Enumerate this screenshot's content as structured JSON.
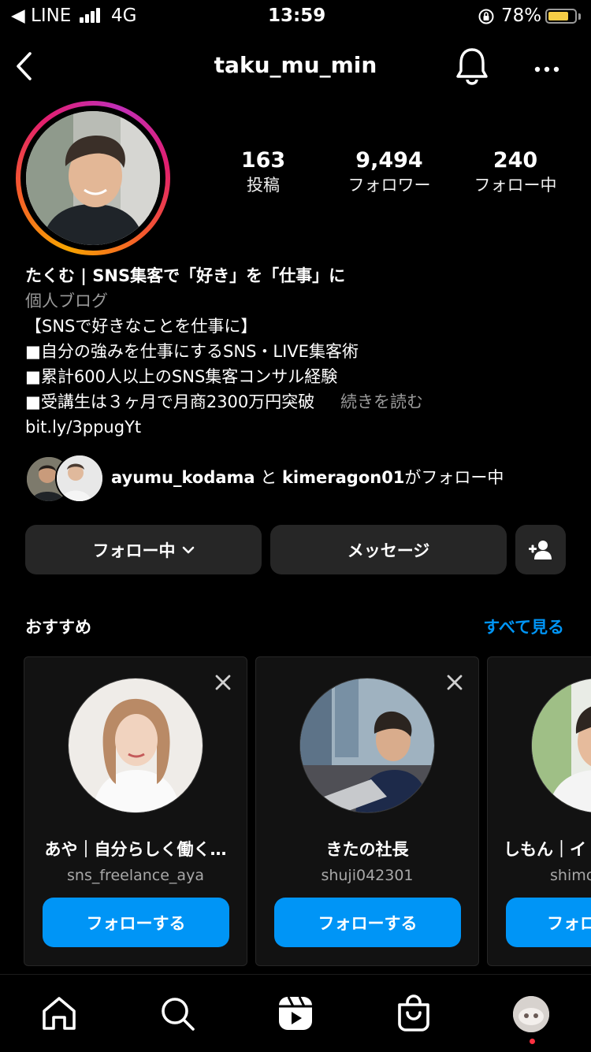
{
  "status_bar": {
    "carrier": "◀ LINE",
    "network": "4G",
    "time": "13:59",
    "battery": "78%",
    "battery_level": 0.78
  },
  "header": {
    "username": "taku_mu_min",
    "icons": [
      "back-icon",
      "bell-icon",
      "more-icon"
    ]
  },
  "profile": {
    "stats": [
      {
        "value": "163",
        "label": "投稿"
      },
      {
        "value": "9,494",
        "label": "フォロワー"
      },
      {
        "value": "240",
        "label": "フォロー中"
      }
    ],
    "name": "たくむ | SNS集客で「好き」を「仕事」に",
    "category": "個人ブログ",
    "bio": [
      "【SNSで好きなことを仕事に】",
      "■自分の強みを仕事にするSNS・LIVE集客術",
      "■累計600人以上のSNS集客コンサル経験",
      "■受講生は３ヶ月で月商2300万円突破"
    ],
    "read_more": "続きを読む",
    "link": "bit.ly/3ppugYt",
    "followed_by": {
      "user1": "ayumu_kodama",
      "connector": "と",
      "user2": "kimeragon01",
      "suffix": "がフォロー中"
    }
  },
  "actions": {
    "following": "フォロー中",
    "message": "メッセージ"
  },
  "suggestions": {
    "title": "おすすめ",
    "see_all": "すべて見る",
    "cards": [
      {
        "name": "あや｜自分らしく働く…",
        "username": "sns_freelance_aya",
        "button": "フォローする"
      },
      {
        "name": "きたの社長",
        "username": "shuji042301",
        "button": "フォローする"
      },
      {
        "name": "しもん｜イ",
        "username": "shimo",
        "button": "フォロ"
      }
    ]
  },
  "colors": {
    "accent": "#0095f6",
    "button_dark": "#262626",
    "battery": "#f7ce46",
    "notification_dot": "#ff3040"
  },
  "tab_bar": [
    "home-icon",
    "search-icon",
    "reels-icon",
    "shop-icon",
    "profile-avatar"
  ]
}
